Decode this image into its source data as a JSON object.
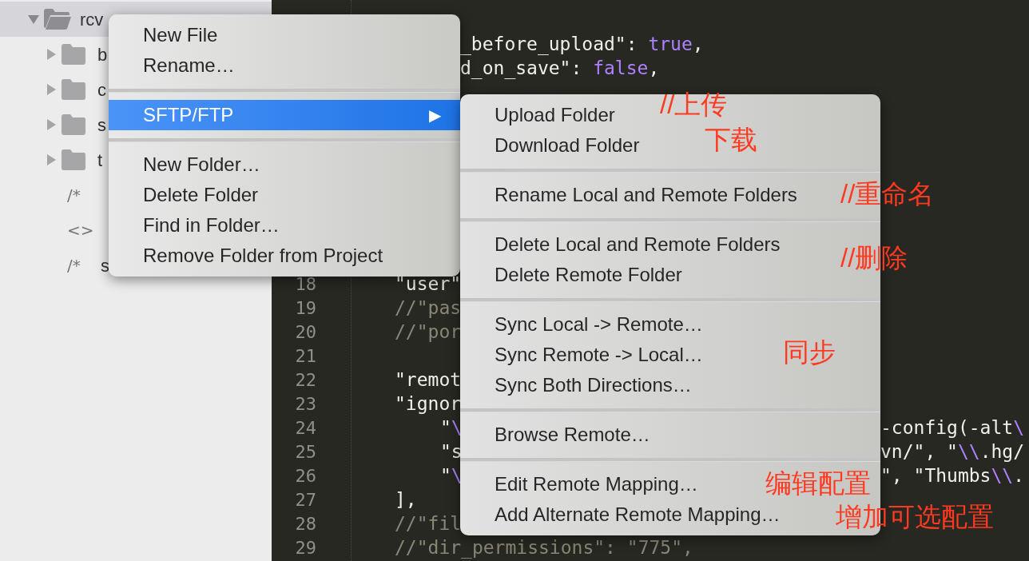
{
  "sidebar": {
    "rows": [
      {
        "kind": "folder",
        "label": "rcv",
        "expanded": true,
        "selected": true
      },
      {
        "kind": "folder",
        "label": "b",
        "expanded": false,
        "selected": false
      },
      {
        "kind": "folder",
        "label": "c",
        "expanded": false,
        "selected": false
      },
      {
        "kind": "folder",
        "label": "s",
        "expanded": false,
        "selected": false
      },
      {
        "kind": "folder",
        "label": "t",
        "expanded": false,
        "selected": false
      },
      {
        "kind": "file",
        "icon_text": "/*",
        "selected": false
      },
      {
        "kind": "file",
        "icon_text": "<>",
        "selected": false
      },
      {
        "kind": "file",
        "icon_text": "/*",
        "label": "s",
        "selected": false
      }
    ]
  },
  "editor": {
    "lines": [
      {
        "fragments": [
          [
            {
              "text": "_before_upload\": ",
              "kind": "plain"
            },
            {
              "text": "true",
              "kind": "constant"
            },
            {
              "text": ",",
              "kind": "plain"
            }
          ]
        ]
      },
      {
        "fragments": [
          [
            {
              "text": "d_on_save\": ",
              "kind": "plain"
            },
            {
              "text": "false",
              "kind": "constant"
            },
            {
              "text": ",",
              "kind": "plain"
            }
          ]
        ]
      },
      {
        "number": "18",
        "fragments": [
          [
            {
              "text": "\"user\"",
              "kind": "plain"
            }
          ]
        ]
      },
      {
        "number": "19",
        "fragments": [
          [
            {
              "text": "//\"pas",
              "kind": "comment"
            }
          ]
        ]
      },
      {
        "number": "20",
        "fragments": [
          [
            {
              "text": "//\"por",
              "kind": "comment"
            }
          ]
        ]
      },
      {
        "number": "21"
      },
      {
        "number": "22",
        "fragments": [
          [
            {
              "text": "\"remot",
              "kind": "plain"
            }
          ]
        ]
      },
      {
        "number": "23",
        "fragments": [
          [
            {
              "text": "\"ignor",
              "kind": "plain"
            }
          ]
        ]
      },
      {
        "number": "24",
        "fragments": [
          [
            {
              "text": "\"",
              "kind": "plain"
            },
            {
              "text": "\\",
              "kind": "constant"
            }
          ],
          [
            {
              "text": "-config(-alt",
              "kind": "plain"
            },
            {
              "text": "\\",
              "kind": "constant"
            }
          ]
        ]
      },
      {
        "number": "25",
        "fragments": [
          [
            {
              "text": "\"s",
              "kind": "plain"
            }
          ],
          [
            {
              "text": "vn/\", \"",
              "kind": "plain"
            },
            {
              "text": "\\\\",
              "kind": "constant"
            },
            {
              "text": ".hg/",
              "kind": "plain"
            }
          ]
        ]
      },
      {
        "number": "26",
        "fragments": [
          [
            {
              "text": "\"",
              "kind": "plain"
            },
            {
              "text": "\\",
              "kind": "constant"
            }
          ],
          [
            {
              "text": "\", \"Thumbs",
              "kind": "plain"
            },
            {
              "text": "\\\\",
              "kind": "constant"
            },
            {
              "text": ".",
              "kind": "plain"
            }
          ]
        ]
      },
      {
        "number": "27",
        "fragments": [
          [
            {
              "text": "],",
              "kind": "plain"
            }
          ]
        ]
      },
      {
        "number": "28",
        "fragments": [
          [
            {
              "text": "//\"fil",
              "kind": "comment"
            }
          ]
        ]
      },
      {
        "number": "29",
        "fragments": [
          [
            {
              "text": "//\"dir_permissions\": \"775\",",
              "kind": "comment"
            }
          ]
        ]
      }
    ]
  },
  "context_menu": {
    "items": [
      {
        "kind": "item",
        "label": "New File",
        "selected": false
      },
      {
        "kind": "item",
        "label": "Rename…",
        "selected": false
      },
      {
        "kind": "separator"
      },
      {
        "kind": "submenu",
        "label": "SFTP/FTP",
        "arrow": "▶",
        "selected": true
      },
      {
        "kind": "separator"
      },
      {
        "kind": "item",
        "label": "New Folder…",
        "selected": false
      },
      {
        "kind": "item",
        "label": "Delete Folder",
        "selected": false
      },
      {
        "kind": "item",
        "label": "Find in Folder…",
        "selected": false
      },
      {
        "kind": "item",
        "label": "Remove Folder from Project",
        "selected": false
      }
    ]
  },
  "submenu": {
    "items": [
      {
        "kind": "item",
        "label": "Upload Folder"
      },
      {
        "kind": "item",
        "label": "Download Folder"
      },
      {
        "kind": "separator"
      },
      {
        "kind": "item",
        "label": "Rename Local and Remote Folders"
      },
      {
        "kind": "separator"
      },
      {
        "kind": "item",
        "label": "Delete Local and Remote Folders"
      },
      {
        "kind": "item",
        "label": "Delete Remote Folder"
      },
      {
        "kind": "separator"
      },
      {
        "kind": "item",
        "label": "Sync Local -> Remote…"
      },
      {
        "kind": "item",
        "label": "Sync Remote -> Local…"
      },
      {
        "kind": "item",
        "label": "Sync Both Directions…"
      },
      {
        "kind": "separator"
      },
      {
        "kind": "item",
        "label": "Browse Remote…"
      },
      {
        "kind": "separator"
      },
      {
        "kind": "item",
        "label": "Edit Remote Mapping…"
      },
      {
        "kind": "item",
        "label": "Add Alternate Remote Mapping…"
      }
    ]
  },
  "annotations": [
    {
      "text": "//上传"
    },
    {
      "text": "下载"
    },
    {
      "text": "//重命名"
    },
    {
      "text": "//删除"
    },
    {
      "text": "同步"
    },
    {
      "text": "编辑配置"
    },
    {
      "text": "增加可选配置"
    }
  ]
}
